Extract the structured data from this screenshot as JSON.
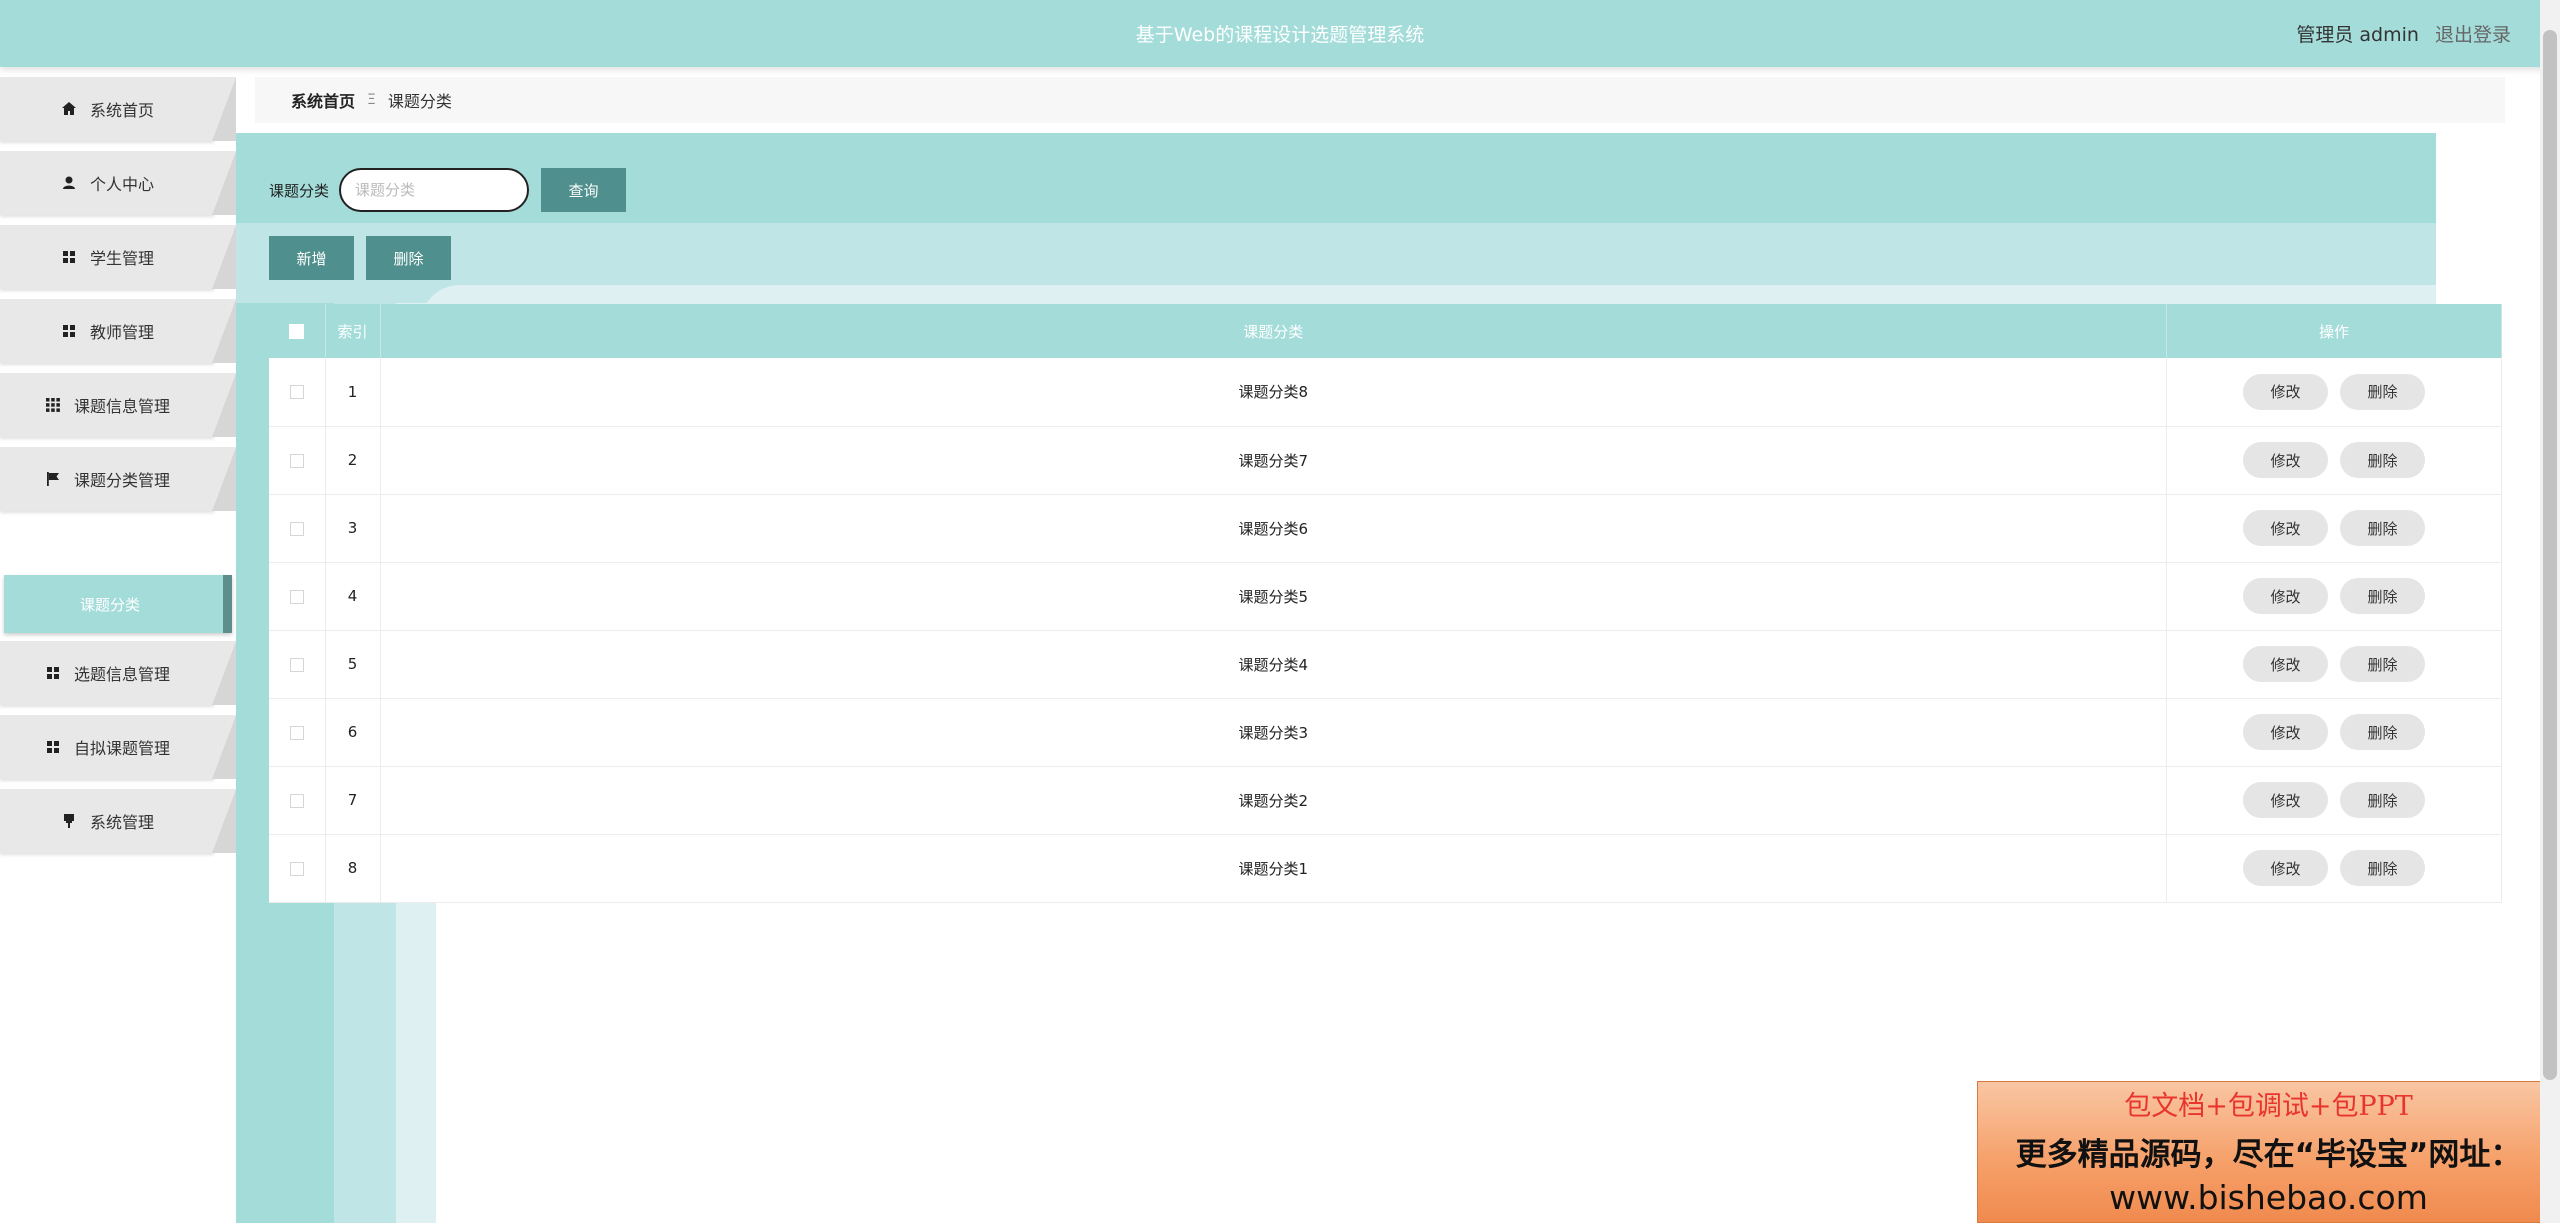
{
  "header": {
    "title": "基于Web的课程设计选题管理系统",
    "user_label": "管理员 admin",
    "logout_label": "退出登录"
  },
  "sidebar": {
    "items": [
      {
        "label": "系统首页",
        "icon": "home-icon"
      },
      {
        "label": "个人中心",
        "icon": "user-icon"
      },
      {
        "label": "学生管理",
        "icon": "grid-icon"
      },
      {
        "label": "教师管理",
        "icon": "grid-icon"
      },
      {
        "label": "课题信息管理",
        "icon": "apps-icon"
      },
      {
        "label": "课题分类管理",
        "icon": "flag-icon"
      },
      {
        "label": "选题信息管理",
        "icon": "grid-icon"
      },
      {
        "label": "自拟课题管理",
        "icon": "grid-icon"
      },
      {
        "label": "系统管理",
        "icon": "pin-icon"
      }
    ],
    "active_sub": "课题分类"
  },
  "breadcrumb": {
    "home": "系统首页",
    "separator": "Ξ",
    "current": "课题分类"
  },
  "search": {
    "label": "课题分类",
    "placeholder": "课题分类",
    "value": "",
    "query_button": "查询"
  },
  "actions": {
    "add": "新增",
    "delete": "删除"
  },
  "table": {
    "headers": [
      "",
      "索引",
      "课题分类",
      "操作"
    ],
    "rows": [
      {
        "index": "1",
        "category": "课题分类8"
      },
      {
        "index": "2",
        "category": "课题分类7"
      },
      {
        "index": "3",
        "category": "课题分类6"
      },
      {
        "index": "4",
        "category": "课题分类5"
      },
      {
        "index": "5",
        "category": "课题分类4"
      },
      {
        "index": "6",
        "category": "课题分类3"
      },
      {
        "index": "7",
        "category": "课题分类2"
      },
      {
        "index": "8",
        "category": "课题分类1"
      }
    ],
    "edit_label": "修改",
    "delete_label": "删除"
  },
  "ad": {
    "line1": "包文档+包调试+包PPT",
    "line2": "更多精品源码，尽在“毕设宝”网址：",
    "line3": "www.bishebao.com"
  },
  "colors": {
    "primary": "#a3dcd9",
    "button_dark": "#4f8f8d",
    "menu_bg": "#e8e8e8"
  }
}
